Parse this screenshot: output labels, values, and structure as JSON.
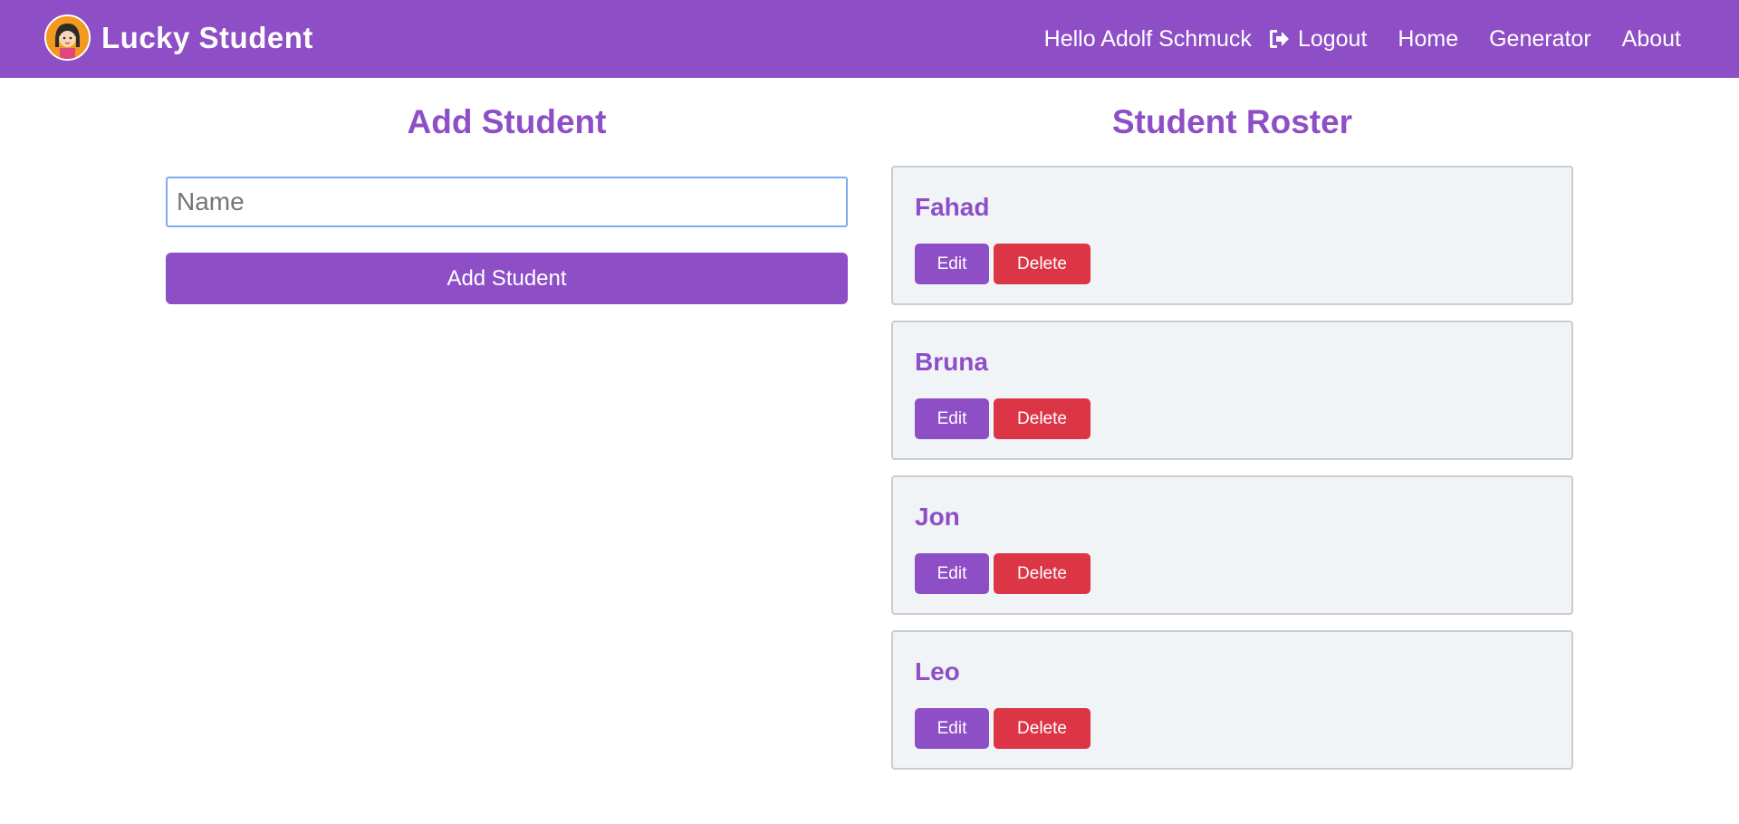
{
  "navbar": {
    "brand": "Lucky Student",
    "greeting": "Hello Adolf Schmuck",
    "links": {
      "logout": "Logout",
      "home": "Home",
      "generator": "Generator",
      "about": "About"
    },
    "icons": {
      "avatar": "student-avatar-icon",
      "logout": "sign-out-icon"
    }
  },
  "add_student": {
    "title": "Add Student",
    "input_placeholder": "Name",
    "input_value": "",
    "button_label": "Add Student"
  },
  "roster": {
    "title": "Student Roster",
    "edit_label": "Edit",
    "delete_label": "Delete",
    "students": [
      {
        "name": "Fahad"
      },
      {
        "name": "Bruna"
      },
      {
        "name": "Jon"
      },
      {
        "name": "Leo"
      }
    ]
  },
  "colors": {
    "brand_purple": "#8e4ec6",
    "delete_red": "#dc3545",
    "card_bg": "#f1f4f7"
  }
}
